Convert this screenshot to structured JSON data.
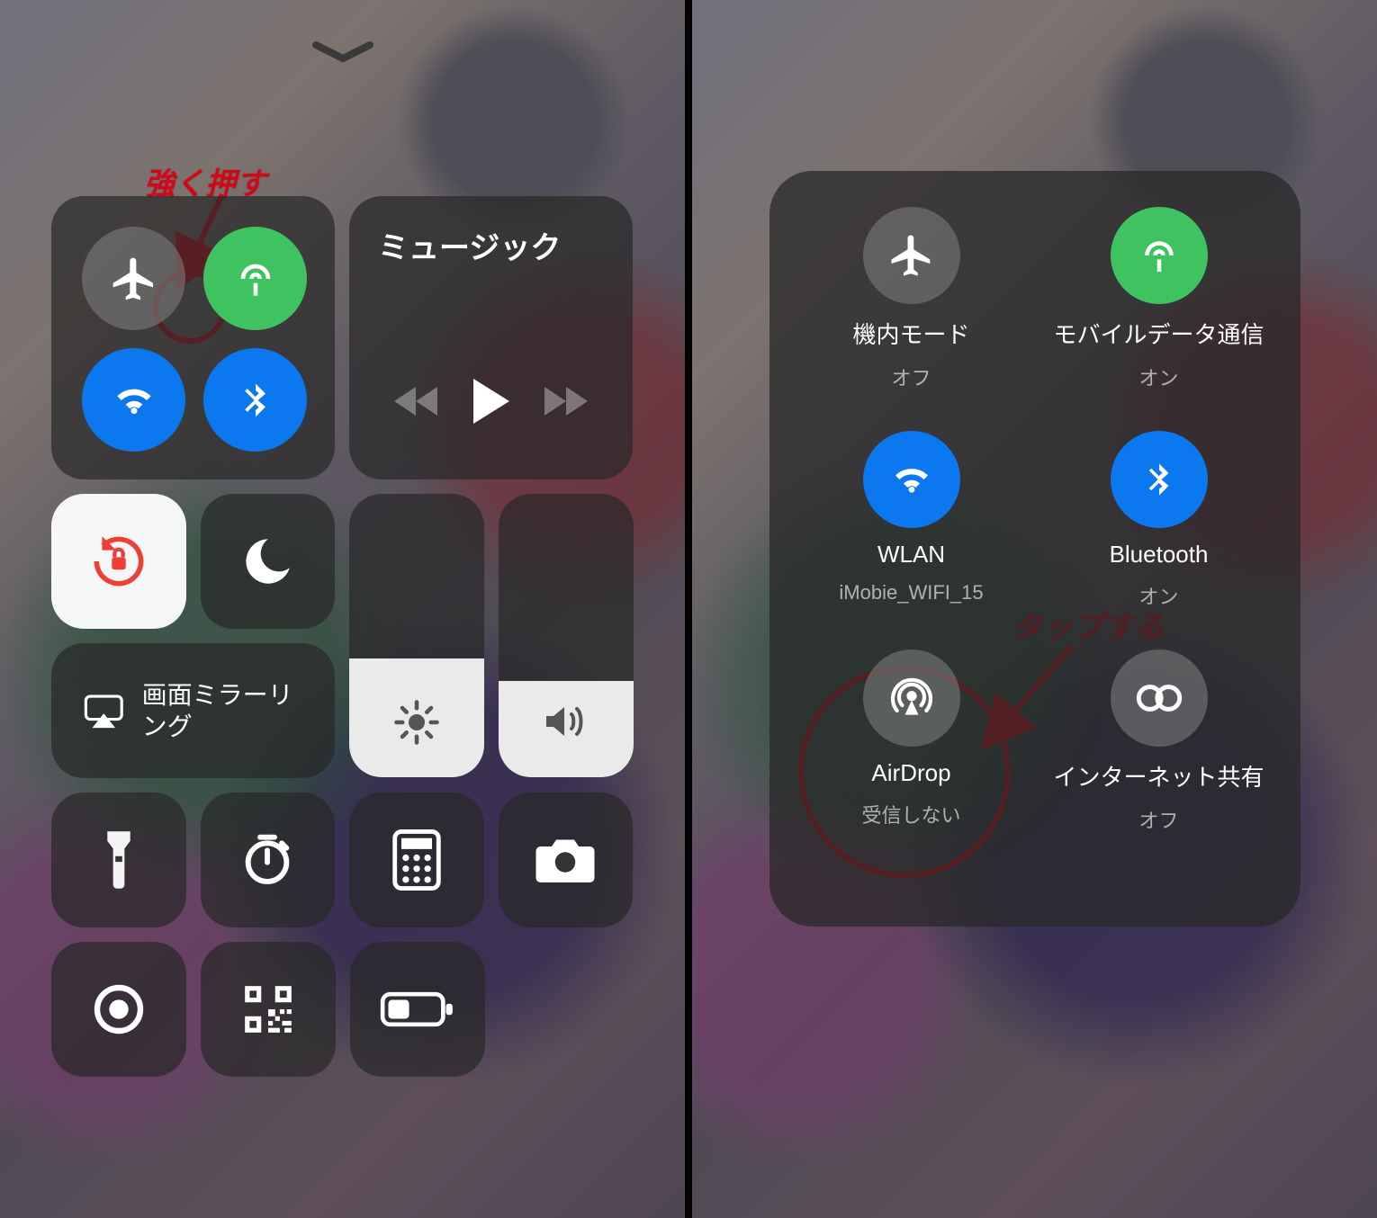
{
  "left": {
    "annotation": "強く押す",
    "music": {
      "title": "ミュージック"
    },
    "mirror": {
      "label": "画面ミラーリング"
    }
  },
  "right": {
    "annotation": "タップする",
    "items": {
      "airplane": {
        "title": "機内モード",
        "sub": "オフ"
      },
      "cellular": {
        "title": "モバイルデータ通信",
        "sub": "オン"
      },
      "wifi": {
        "title": "WLAN",
        "sub": "iMobie_WIFI_15"
      },
      "bluetooth": {
        "title": "Bluetooth",
        "sub": "オン"
      },
      "airdrop": {
        "title": "AirDrop",
        "sub": "受信しない"
      },
      "hotspot": {
        "title": "インターネット共有",
        "sub": "オフ"
      }
    }
  }
}
